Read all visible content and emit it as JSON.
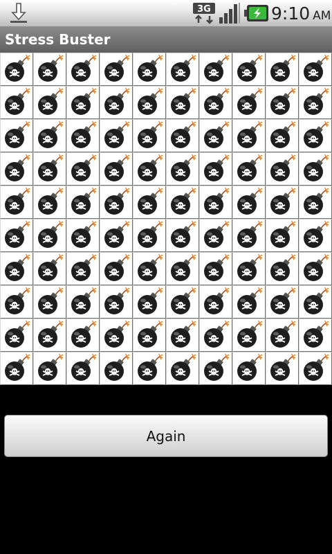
{
  "status_bar": {
    "notification_icon": "download-icon",
    "network_label": "3G",
    "signal_icon": "signal-strength-icon",
    "battery_icon": "battery-charging-icon",
    "time": "9:10",
    "ampm": "AM"
  },
  "app": {
    "title": "Stress Buster"
  },
  "grid": {
    "rows": 10,
    "columns": 10,
    "cell_icon": "bomb-icon"
  },
  "actions": {
    "again_label": "Again"
  },
  "colors": {
    "background": "#000000",
    "title_bar": "#767676",
    "cell_background": "#ffffff",
    "bomb": "#1e1e1e",
    "fuse_spark": "#e07a1e"
  }
}
